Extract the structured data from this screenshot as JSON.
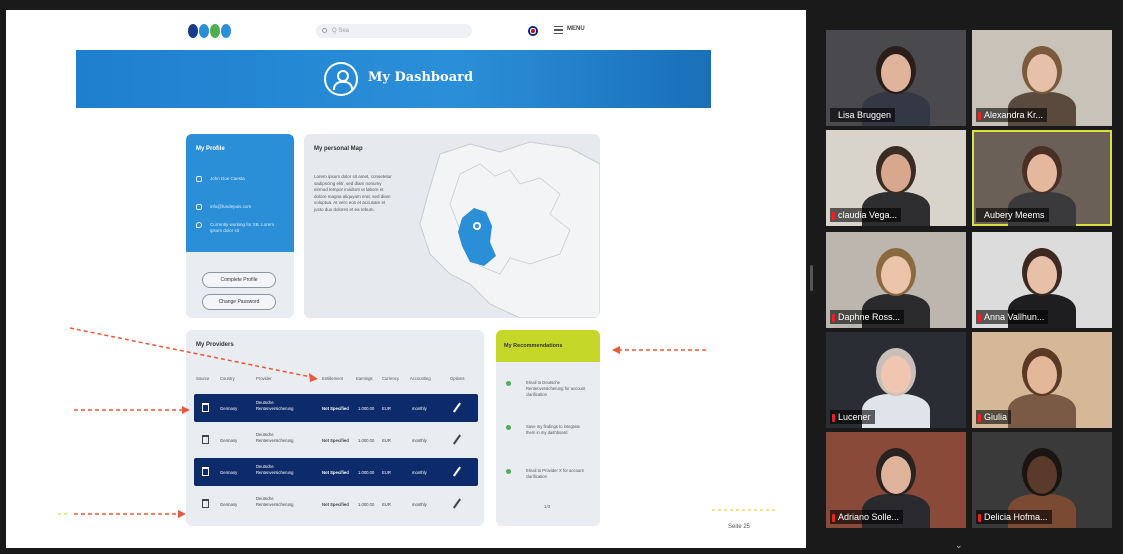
{
  "shared_slide": {
    "search_placeholder": "Q Sea",
    "menu_label": "MENU",
    "banner_title": "My Dashboard",
    "profile": {
      "title": "My Profile",
      "rows": [
        {
          "icon": "user-icon",
          "text": "John Doe Caesta"
        },
        {
          "icon": "mail-icon",
          "text": "info@fundepuis.com"
        },
        {
          "icon": "location-pin-icon",
          "text": "Currently working for XB. Lorem ipsum dolor sit"
        }
      ],
      "complete_profile_label": "Complete Profile",
      "change_password_label": "Change Password"
    },
    "map": {
      "title": "My personal Map",
      "text": "Lorem ipsum dolor sit amet, consetetur sadipscing elitr, sed diam nonumy eirmod tempor invidunt ut labore et dolore magna aliquyam erat, sed diam voluptua. At vero eos et accusam et justo duo dolores et ea rebum.",
      "highlight_color": "#2b8fd8"
    },
    "providers": {
      "title": "My Providers",
      "columns": [
        "Source",
        "Country",
        "Provider",
        "Entitlement",
        "Earnings",
        "Currency",
        "Accounting",
        "Options"
      ],
      "rows": [
        {
          "country": "Germany",
          "provider": "Deutsche Rentenversicherung",
          "entitlement": "Not Specified",
          "earnings": "1.000.00",
          "currency": "EUR",
          "accounting": "monthly",
          "style": "dark"
        },
        {
          "country": "Germany",
          "provider": "Deutsche Rentenversicherung",
          "entitlement": "Not Specified",
          "earnings": "1.000.00",
          "currency": "EUR",
          "accounting": "monthly",
          "style": "light"
        },
        {
          "country": "Germany",
          "provider": "Deutsche Rentenversicherung",
          "entitlement": "Not Specified",
          "earnings": "1.000.00",
          "currency": "EUR",
          "accounting": "monthly",
          "style": "dark"
        },
        {
          "country": "Germany",
          "provider": "Deutsche Rentenversicherung",
          "entitlement": "Not Specified",
          "earnings": "1.000.00",
          "currency": "EUR",
          "accounting": "monthly",
          "style": "light"
        }
      ]
    },
    "recommendations": {
      "title": "My Recommendations",
      "items": [
        "Email to Deutsche Rentenversicherung for account clarification",
        "Save my findings to integrate them in my dashboard",
        "Email to Provider X for account clarification"
      ],
      "page": "1/3"
    },
    "slide_number": "Seite 25"
  },
  "participants": [
    {
      "name": "Lisa Bruggen",
      "muted": false,
      "active": false,
      "bg": "#4a4a4e",
      "skin": "#e0b49a",
      "hair": "#2a1e1a",
      "shirt": "#333844"
    },
    {
      "name": "Alexandra Kr...",
      "muted": true,
      "active": false,
      "bg": "#c9c2b8",
      "skin": "#e6c0a8",
      "hair": "#7a5a3a",
      "shirt": "#5a4a3e"
    },
    {
      "name": "claudia Vega...",
      "muted": true,
      "active": false,
      "bg": "#d8d4cc",
      "skin": "#d8a88e",
      "hair": "#3a2c24",
      "shirt": "#2e2e30"
    },
    {
      "name": "Aubery Meems",
      "muted": false,
      "active": true,
      "bg": "#6a6058",
      "skin": "#e4b89c",
      "hair": "#4a3024",
      "shirt": "#3a3a3c"
    },
    {
      "name": "Daphne Ross...",
      "muted": true,
      "active": false,
      "bg": "#bcb6ae",
      "skin": "#ecc4aa",
      "hair": "#8a6840",
      "shirt": "#2a2a2c"
    },
    {
      "name": "Anna Vallhun...",
      "muted": true,
      "active": false,
      "bg": "#dcdcdc",
      "skin": "#e8c0a8",
      "hair": "#3c2a22",
      "shirt": "#1e1e20"
    },
    {
      "name": "Lucener",
      "muted": true,
      "active": false,
      "bg": "#2a2e34",
      "skin": "#f0c6b0",
      "hair": "#c8c0b8",
      "shirt": "#dfe4ea"
    },
    {
      "name": "Giulia",
      "muted": true,
      "active": false,
      "bg": "#d4b898",
      "skin": "#e2b898",
      "hair": "#5a3a24",
      "shirt": "#7a5a44"
    },
    {
      "name": "Adriano Solle...",
      "muted": true,
      "active": false,
      "bg": "#8a4a3a",
      "skin": "#e0b49a",
      "hair": "#2a2220",
      "shirt": "#2a2a2e"
    },
    {
      "name": "Delicia Hofma...",
      "muted": true,
      "active": false,
      "bg": "#3a3a3a",
      "skin": "#5a3a2a",
      "hair": "#1a1412",
      "shirt": "#7a4a32"
    }
  ]
}
